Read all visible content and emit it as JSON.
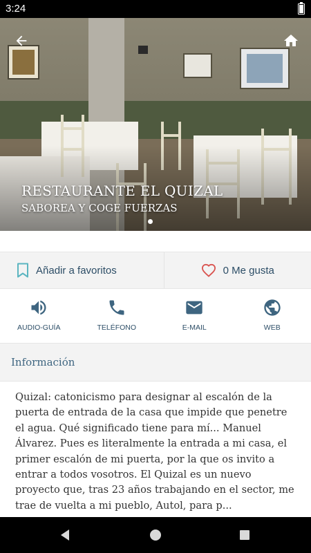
{
  "status_bar": {
    "time": "3:24"
  },
  "hero": {
    "title": "RESTAURANTE EL QUIZAL",
    "subtitle": "SABOREA Y COGE FUERZAS",
    "back_icon": "arrow-left-icon",
    "home_icon": "home-icon"
  },
  "actions": {
    "favorite_label": "Añadir a favoritos",
    "likes_label": "0 Me gusta"
  },
  "contact": [
    {
      "label": "AUDIO-GUÍA",
      "icon": "speaker-icon"
    },
    {
      "label": "TELÉFONO",
      "icon": "phone-icon"
    },
    {
      "label": "E-MAIL",
      "icon": "mail-icon"
    },
    {
      "label": "WEB",
      "icon": "globe-icon"
    }
  ],
  "info": {
    "heading": "Información",
    "text": "Quizal: catonicismo para designar al escalón de la puerta de entrada de la casa que impide que penetre el agua. Qué significado tiene para mí... Manuel Álvarez. Pues es literalmente la entrada a mi casa, el primer escalón de mi puerta, por la que os invito a entrar a todos vosotros. El Quizal es un nuevo proyecto que, tras 23 años trabajando en el sector, me trae de vuelta a mi pueblo, Autol, para p..."
  },
  "colors": {
    "accent": "#2c4d66",
    "heart": "#d9534f",
    "bookmark": "#5bb5c0",
    "icon_blue": "#3e6580"
  }
}
